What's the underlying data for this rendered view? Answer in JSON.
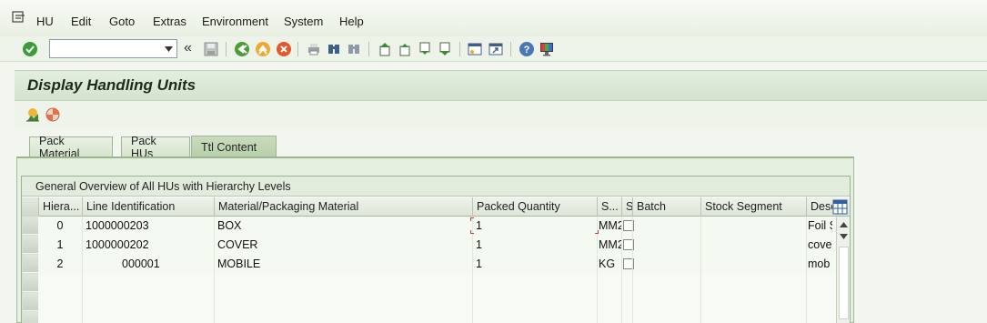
{
  "menu": {
    "items": [
      {
        "label": "HU"
      },
      {
        "label": "Edit"
      },
      {
        "label": "Goto"
      },
      {
        "label": "Extras"
      },
      {
        "label": "Environment"
      },
      {
        "label": "System"
      },
      {
        "label": "Help"
      }
    ]
  },
  "toolbar": {
    "command_field_value": "",
    "icons": [
      "enter-icon",
      "command-field",
      "back-arrows-icon",
      "save-icon",
      "back-icon",
      "exit-icon",
      "cancel-icon",
      "print-icon",
      "find-icon",
      "find-next-icon",
      "first-page-icon",
      "previous-page-icon",
      "next-page-icon",
      "last-page-icon",
      "create-session-icon",
      "create-shortcut-icon",
      "help-icon",
      "customize-layout-icon"
    ]
  },
  "title": "Display Handling Units",
  "app_toolbar": {
    "icons": [
      "hu-monitor-icon",
      "pie-chart-icon"
    ]
  },
  "tabs": [
    {
      "label": "Pack Material",
      "active": false
    },
    {
      "label": "Pack HUs",
      "active": false
    },
    {
      "label": "Ttl Content",
      "active": true
    }
  ],
  "grid": {
    "title": "General Overview of All HUs with Hierarchy Levels",
    "columns": [
      "Hiera...",
      "Line Identification",
      "Material/Packaging Material",
      "Packed Quantity",
      "S...",
      "S",
      "Batch",
      "Stock Segment",
      "Desc"
    ],
    "rows": [
      {
        "hierarchy": "0",
        "line_id": "1000000203",
        "material": "BOX",
        "packed_qty": "1",
        "unit": "MM2",
        "batch": "",
        "stock_segment": "",
        "desc": "Foil S"
      },
      {
        "hierarchy": "1",
        "line_id": "1000000202",
        "material": "COVER",
        "packed_qty": "1",
        "unit": "MM2",
        "batch": "",
        "stock_segment": "",
        "desc": "cove"
      },
      {
        "hierarchy": "2",
        "line_id": "000001",
        "material": "MOBILE",
        "packed_qty": "1",
        "unit": "KG",
        "batch": "",
        "stock_segment": "",
        "desc": "mob"
      }
    ]
  }
}
